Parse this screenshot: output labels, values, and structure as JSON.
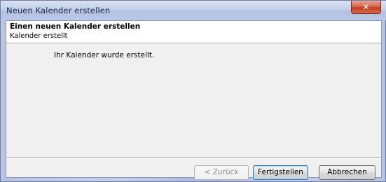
{
  "window": {
    "title": "Neuen Kalender erstellen",
    "close_glyph": "✕"
  },
  "header": {
    "title": "Einen neuen Kalender erstellen",
    "subtitle": "Kalender erstellt"
  },
  "main": {
    "message": "Ihr Kalender wurde erstellt."
  },
  "buttons": {
    "back_label": "< Zurück",
    "finish_label": "Fertigstellen",
    "cancel_label": "Abbrechen"
  },
  "colors": {
    "titlebar": "#c3cfea",
    "close_button": "#c33e22",
    "client_background": "#f0f0f0"
  }
}
